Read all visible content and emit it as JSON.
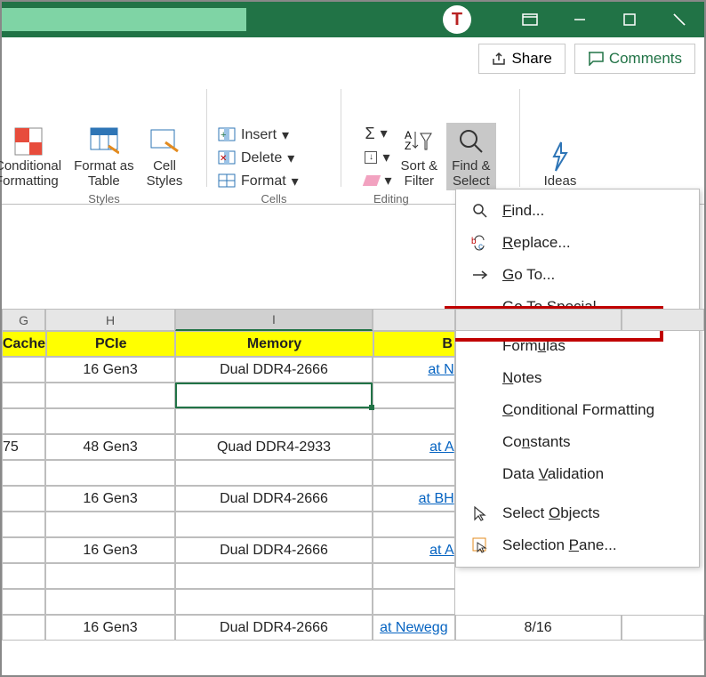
{
  "titlebar": {
    "app_icon_letter": "T"
  },
  "sharebar": {
    "share": "Share",
    "comments": "Comments"
  },
  "ribbon": {
    "styles_group": "Styles",
    "cond_fmt": "Conditional\nFormatting",
    "fmt_table": "Format as\nTable",
    "cell_styles": "Cell\nStyles",
    "cells_group": "Cells",
    "insert": "Insert",
    "delete": "Delete",
    "format": "Format",
    "editing_group": "Editing",
    "sort_filter": "Sort &\nFilter",
    "find_select": "Find &\nSelect",
    "ideas": "Ideas"
  },
  "dropdown": {
    "find": "Find...",
    "replace": "Replace...",
    "goto": "Go To...",
    "gotospecial": "Go To Special...",
    "formulas": "Formulas",
    "notes": "Notes",
    "cond_fmt": "Conditional Formatting",
    "constants": "Constants",
    "data_val": "Data Validation",
    "sel_obj": "Select Objects",
    "sel_pane": "Selection Pane..."
  },
  "columns": {
    "G": "G",
    "H": "H",
    "I": "I"
  },
  "headers": {
    "G": "Cache",
    "H": "PCIe",
    "I": "Memory",
    "J": "B"
  },
  "rows": [
    {
      "G": "",
      "H": "16 Gen3",
      "I": "Dual DDR4-2666",
      "J": "at N",
      "K": "",
      "L": ""
    },
    {
      "G": "",
      "H": "",
      "I": "",
      "J": "",
      "K": "",
      "L": ""
    },
    {
      "G": "",
      "H": "",
      "I": "",
      "J": "",
      "K": "",
      "L": ""
    },
    {
      "G": "75",
      "H": "48 Gen3",
      "I": "Quad DDR4-2933",
      "J": "at A",
      "K": "",
      "L": ""
    },
    {
      "G": "",
      "H": "",
      "I": "",
      "J": "",
      "K": "",
      "L": ""
    },
    {
      "G": "",
      "H": "16 Gen3",
      "I": "Dual DDR4-2666",
      "J": "at BH",
      "K": "",
      "L": ""
    },
    {
      "G": "",
      "H": "",
      "I": "",
      "J": "",
      "K": "",
      "L": ""
    },
    {
      "G": "",
      "H": "16 Gen3",
      "I": "Dual DDR4-2666",
      "J": "at A",
      "K": "",
      "L": ""
    },
    {
      "G": "",
      "H": "",
      "I": "",
      "J": "",
      "K": "",
      "L": ""
    },
    {
      "G": "",
      "H": "",
      "I": "",
      "J": "",
      "K": "",
      "L": ""
    },
    {
      "G": "",
      "H": "16 Gen3",
      "I": "Dual DDR4-2666",
      "J": "at Newegg",
      "K": "8/16",
      "L": ""
    }
  ]
}
